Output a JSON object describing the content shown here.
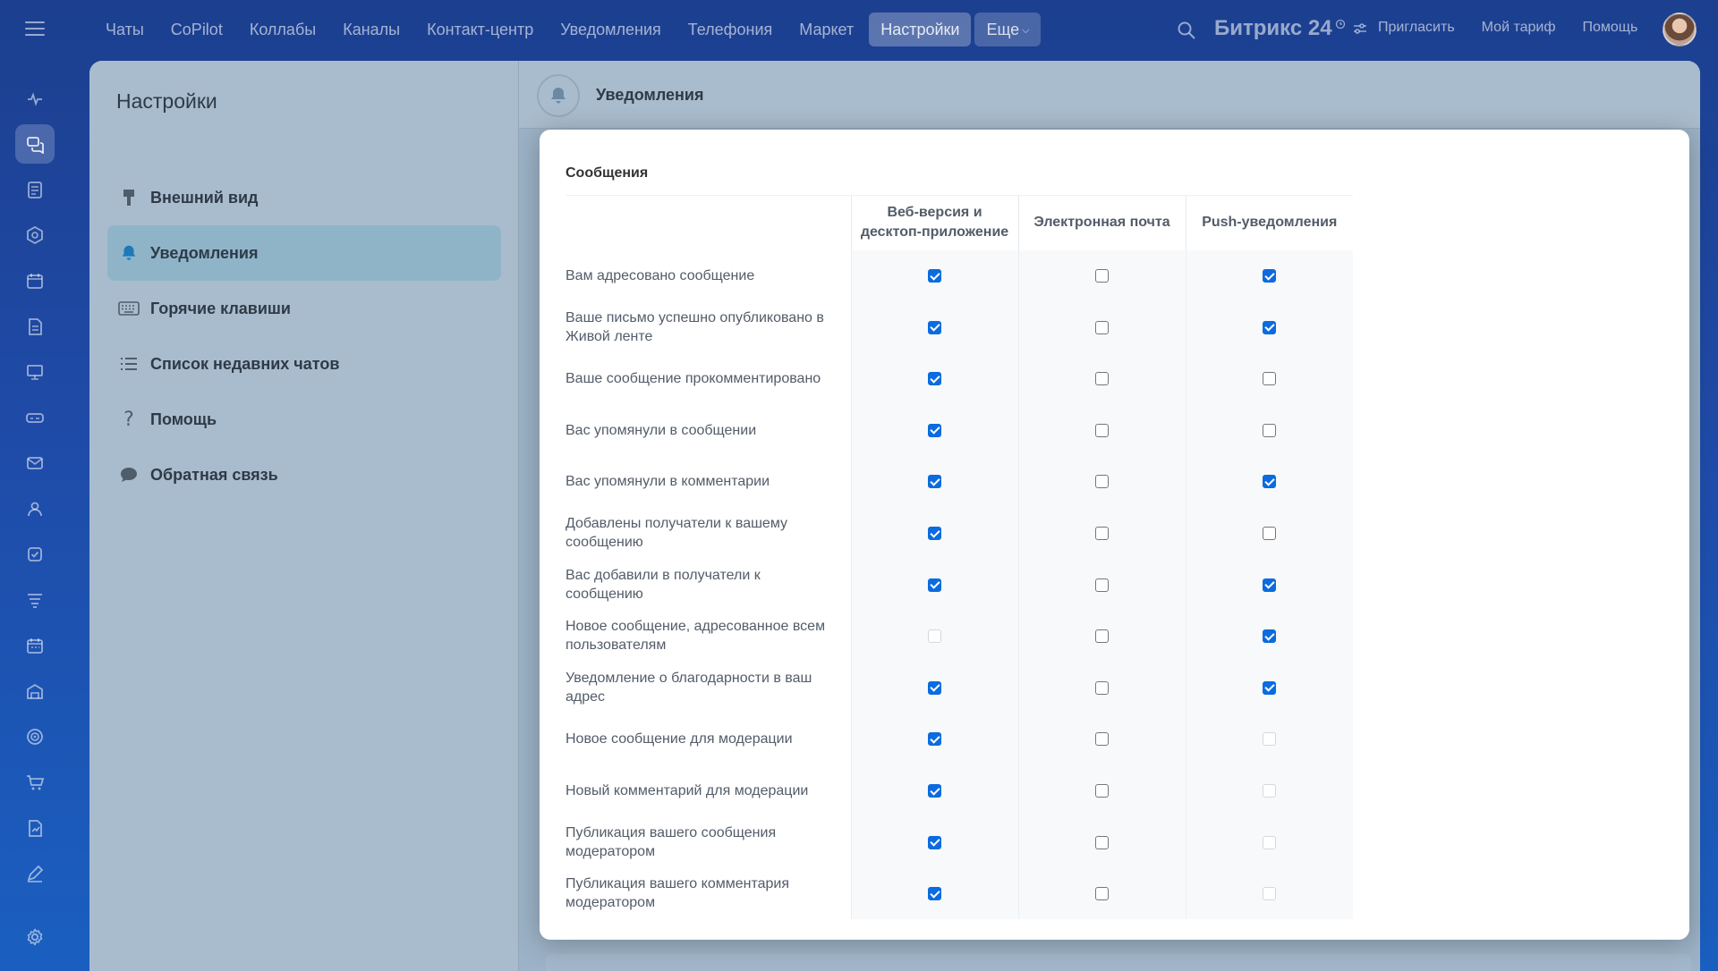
{
  "topnav": {
    "items": [
      "Чаты",
      "CoPilot",
      "Коллабы",
      "Каналы",
      "Контакт-центр",
      "Уведомления",
      "Телефония",
      "Маркет",
      "Настройки"
    ],
    "active_index": 8,
    "more_label": "Еще"
  },
  "brand": {
    "name": "Битрикс 24"
  },
  "toplinks": {
    "invite": "Пригласить",
    "tariff": "Мой тариф",
    "help": "Помощь"
  },
  "rail": {
    "icons": [
      "pulse-icon",
      "chats-icon",
      "feed-icon",
      "hexagon-icon",
      "calendar-icon",
      "document-icon",
      "presentation-icon",
      "drive-icon",
      "mail-icon",
      "group-icon",
      "tasks-icon",
      "filter-icon",
      "schedule-icon",
      "store-icon",
      "target-icon",
      "cart-icon",
      "sign-icon",
      "pen-icon"
    ],
    "active_index": 1
  },
  "settings": {
    "title": "Настройки",
    "menu": [
      {
        "label": "Внешний вид",
        "icon": "brush-icon"
      },
      {
        "label": "Уведомления",
        "icon": "bell-icon"
      },
      {
        "label": "Горячие клавиши",
        "icon": "keyboard-icon"
      },
      {
        "label": "Список недавних чатов",
        "icon": "list-icon"
      },
      {
        "label": "Помощь",
        "icon": "question-icon"
      },
      {
        "label": "Обратная связь",
        "icon": "speech-bubble-icon"
      }
    ],
    "active_index": 1,
    "header_title": "Уведомления"
  },
  "modal": {
    "section_title": "Сообщения",
    "columns": [
      "Веб-версия и десктоп-приложение",
      "Электронная почта",
      "Push-уведомления"
    ],
    "rows": [
      {
        "label": "Вам адресовано сообщение",
        "values": [
          "on",
          "off",
          "on"
        ]
      },
      {
        "label": "Ваше письмо успешно опубликовано в Живой ленте",
        "values": [
          "on",
          "off",
          "on"
        ]
      },
      {
        "label": "Ваше сообщение прокомментировано",
        "values": [
          "on",
          "off",
          "off"
        ]
      },
      {
        "label": "Вас упомянули в сообщении",
        "values": [
          "on",
          "off",
          "off"
        ]
      },
      {
        "label": "Вас упомянули в комментарии",
        "values": [
          "on",
          "off",
          "on"
        ]
      },
      {
        "label": "Добавлены получатели к вашему сообщению",
        "values": [
          "on",
          "off",
          "off"
        ]
      },
      {
        "label": "Вас добавили в получатели к сообщению",
        "values": [
          "on",
          "off",
          "on"
        ]
      },
      {
        "label": "Новое сообщение, адресованное всем пользователям",
        "values": [
          "disabled",
          "off",
          "on"
        ]
      },
      {
        "label": "Уведомление о благодарности в ваш адрес",
        "values": [
          "on",
          "off",
          "on"
        ]
      },
      {
        "label": "Новое сообщение для модерации",
        "values": [
          "on",
          "off",
          "disabled"
        ]
      },
      {
        "label": "Новый комментарий для модерации",
        "values": [
          "on",
          "off",
          "disabled"
        ]
      },
      {
        "label": "Публикация вашего сообщения модератором",
        "values": [
          "on",
          "off",
          "disabled"
        ]
      },
      {
        "label": "Публикация вашего комментария модератором",
        "values": [
          "on",
          "off",
          "disabled"
        ]
      }
    ]
  }
}
